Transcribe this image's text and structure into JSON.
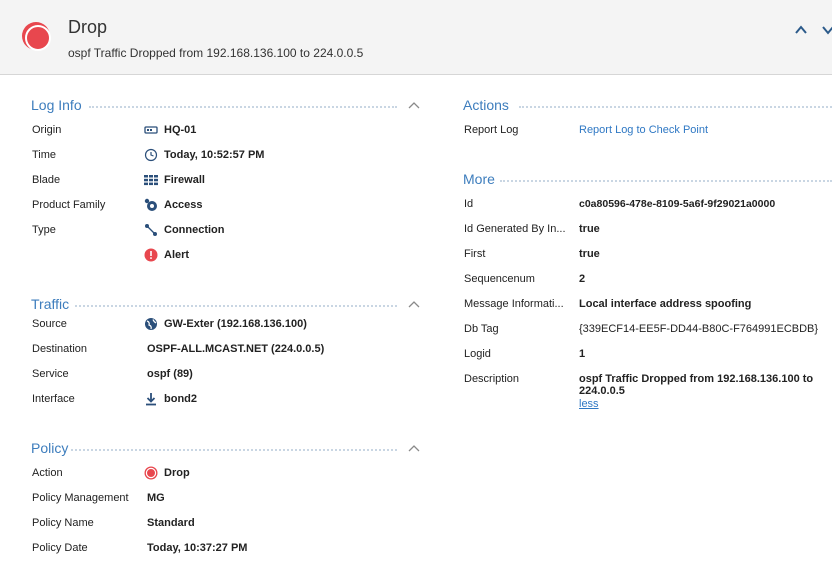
{
  "header": {
    "title": "Drop",
    "subtitle": "ospf Traffic Dropped from 192.168.136.100 to 224.0.0.5",
    "icons": {
      "status": "drop-icon",
      "collapse": "chevron-up-icon",
      "expand": "chevron-down-icon"
    },
    "colors": {
      "drop": "#e8474e",
      "accent": "#3d7dbd"
    }
  },
  "log_info": {
    "heading": "Log Info",
    "rows": [
      {
        "label": "Origin",
        "value": "HQ-01",
        "icon": "gateway-icon"
      },
      {
        "label": "Time",
        "value": "Today, 10:52:57 PM",
        "icon": "clock-icon"
      },
      {
        "label": "Blade",
        "value": "Firewall",
        "icon": "firewall-icon"
      },
      {
        "label": "Product Family",
        "value": "Access",
        "icon": "access-icon"
      },
      {
        "label": "Type",
        "value": "Connection",
        "icon": "connection-icon"
      },
      {
        "label": "",
        "value": "Alert",
        "icon": "alert-icon"
      }
    ]
  },
  "traffic": {
    "heading": "Traffic",
    "rows": [
      {
        "label": "Source",
        "value": "GW-Exter (192.168.136.100)",
        "icon": "globe-icon"
      },
      {
        "label": "Destination",
        "value": "OSPF-ALL.MCAST.NET (224.0.0.5)"
      },
      {
        "label": "Service",
        "value": "ospf (89)"
      },
      {
        "label": "Interface",
        "value": "bond2",
        "icon": "inbound-arrow-icon"
      }
    ]
  },
  "policy": {
    "heading": "Policy",
    "rows": [
      {
        "label": "Action",
        "value": "Drop",
        "icon": "drop-icon"
      },
      {
        "label": "Policy Management",
        "value": "MG"
      },
      {
        "label": "Policy Name",
        "value": "Standard"
      },
      {
        "label": "Policy Date",
        "value": "Today, 10:37:27 PM"
      }
    ]
  },
  "actions": {
    "heading": "Actions",
    "rows": [
      {
        "label": "Report Log",
        "value": "Report Log to Check Point"
      }
    ]
  },
  "more": {
    "heading": "More",
    "rows": [
      {
        "label": "Id",
        "value": "c0a80596-478e-8109-5a6f-9f29021a0000"
      },
      {
        "label": "Id Generated By In...",
        "value": "true"
      },
      {
        "label": "First",
        "value": "true"
      },
      {
        "label": "Sequencenum",
        "value": "2"
      },
      {
        "label": "Message Informati...",
        "value": "Local interface address spoofing"
      },
      {
        "label": "Db Tag",
        "value": "{339ECF14-EE5F-DD44-B80C-F764991ECBDB}"
      },
      {
        "label": "Logid",
        "value": "1"
      },
      {
        "label": "Description",
        "value_line1": "ospf Traffic Dropped from 192.168.136.100 to",
        "value_line2": "224.0.0.5",
        "less": "less"
      }
    ]
  }
}
